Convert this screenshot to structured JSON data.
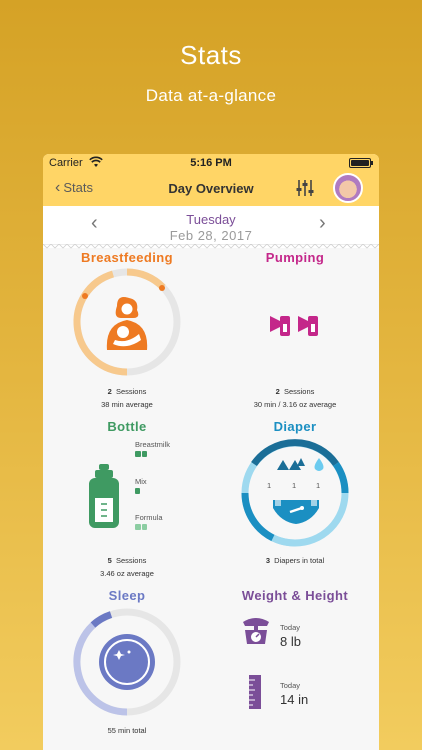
{
  "promo": {
    "title": "Stats",
    "subtitle": "Data at-a-glance"
  },
  "status_bar": {
    "carrier": "Carrier",
    "time": "5:16 PM"
  },
  "nav": {
    "back_label": "Stats",
    "title": "Day Overview"
  },
  "date": {
    "day": "Tuesday",
    "date": "Feb 28, 2017"
  },
  "colors": {
    "breastfeeding": "#ee7a22",
    "pumping": "#c4278a",
    "bottle": "#3f9a62",
    "diaper": "#1b8fc2",
    "sleep": "#6b79c4",
    "weight_height": "#7b4e98"
  },
  "breastfeeding": {
    "title": "Breastfeeding",
    "sessions": "2",
    "sessions_label": "Sessions",
    "average": "38 min average"
  },
  "pumping": {
    "title": "Pumping",
    "sessions": "2",
    "sessions_label": "Sessions",
    "average": "30 min / 3.16 oz average"
  },
  "bottle": {
    "title": "Bottle",
    "legend": [
      "Breastmilk",
      "Mix",
      "Formula"
    ],
    "sessions": "5",
    "sessions_label": "Sessions",
    "average": "3.46 oz average"
  },
  "diaper": {
    "title": "Diaper",
    "counts": [
      "1",
      "1",
      "1"
    ],
    "total_num": "3",
    "total_label": "Diapers in total"
  },
  "sleep": {
    "title": "Sleep",
    "total": "55 min total"
  },
  "weight_height": {
    "title": "Weight & Height",
    "weight_label": "Today",
    "weight_value": "8 lb",
    "height_label": "Today",
    "height_value": "14 in"
  }
}
